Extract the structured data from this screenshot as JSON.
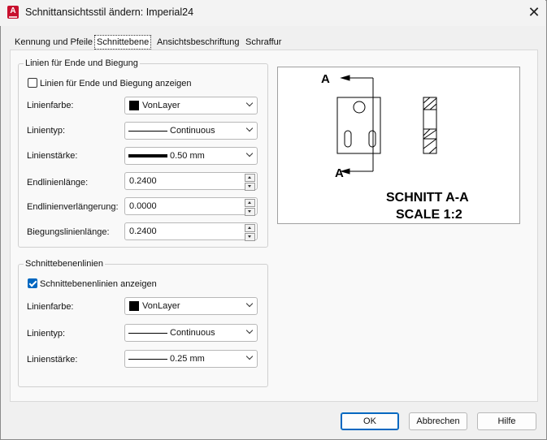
{
  "window": {
    "title": "Schnittansichtsstil ändern: Imperial24",
    "icon_letter": "A"
  },
  "tabs": [
    {
      "label": "Kennung und Pfeile",
      "active": false
    },
    {
      "label": "Schnittebene",
      "active": true
    },
    {
      "label": "Ansichtsbeschriftung",
      "active": false
    },
    {
      "label": "Schraffur",
      "active": false
    }
  ],
  "end_bend": {
    "group_label": "Linien für Ende und Biegung",
    "show_checkbox": {
      "label": "Linien für Ende und Biegung anzeigen",
      "checked": false
    },
    "line_color": {
      "label": "Linienfarbe:",
      "value": "VonLayer"
    },
    "line_type": {
      "label": "Linientyp:",
      "value": "Continuous"
    },
    "line_weight": {
      "label": "Linienstärke:",
      "value": "0.50 mm"
    },
    "end_line_length": {
      "label": "Endlinienlänge:",
      "value": "0.2400"
    },
    "end_line_overshoot": {
      "label": "Endlinienverlängerung:",
      "value": "0.0000"
    },
    "bend_line_length": {
      "label": "Biegungslinienlänge:",
      "value": "0.2400"
    }
  },
  "plane_lines": {
    "group_label": "Schnittebenenlinien",
    "show_checkbox": {
      "label": "Schnittebenenlinien anzeigen",
      "checked": true
    },
    "line_color": {
      "label": "Linienfarbe:",
      "value": "VonLayer"
    },
    "line_type": {
      "label": "Linientyp:",
      "value": "Continuous"
    },
    "line_weight": {
      "label": "Linienstärke:",
      "value": "0.25 mm"
    }
  },
  "preview": {
    "marker_top": "A",
    "marker_bottom": "A",
    "title_line1": "SCHNITT A-A",
    "title_line2": "SCALE 1:2"
  },
  "buttons": {
    "ok": "OK",
    "cancel": "Abbrechen",
    "help": "Hilfe"
  },
  "colors": {
    "accent": "#0067c0",
    "brand": "#c8102e"
  }
}
